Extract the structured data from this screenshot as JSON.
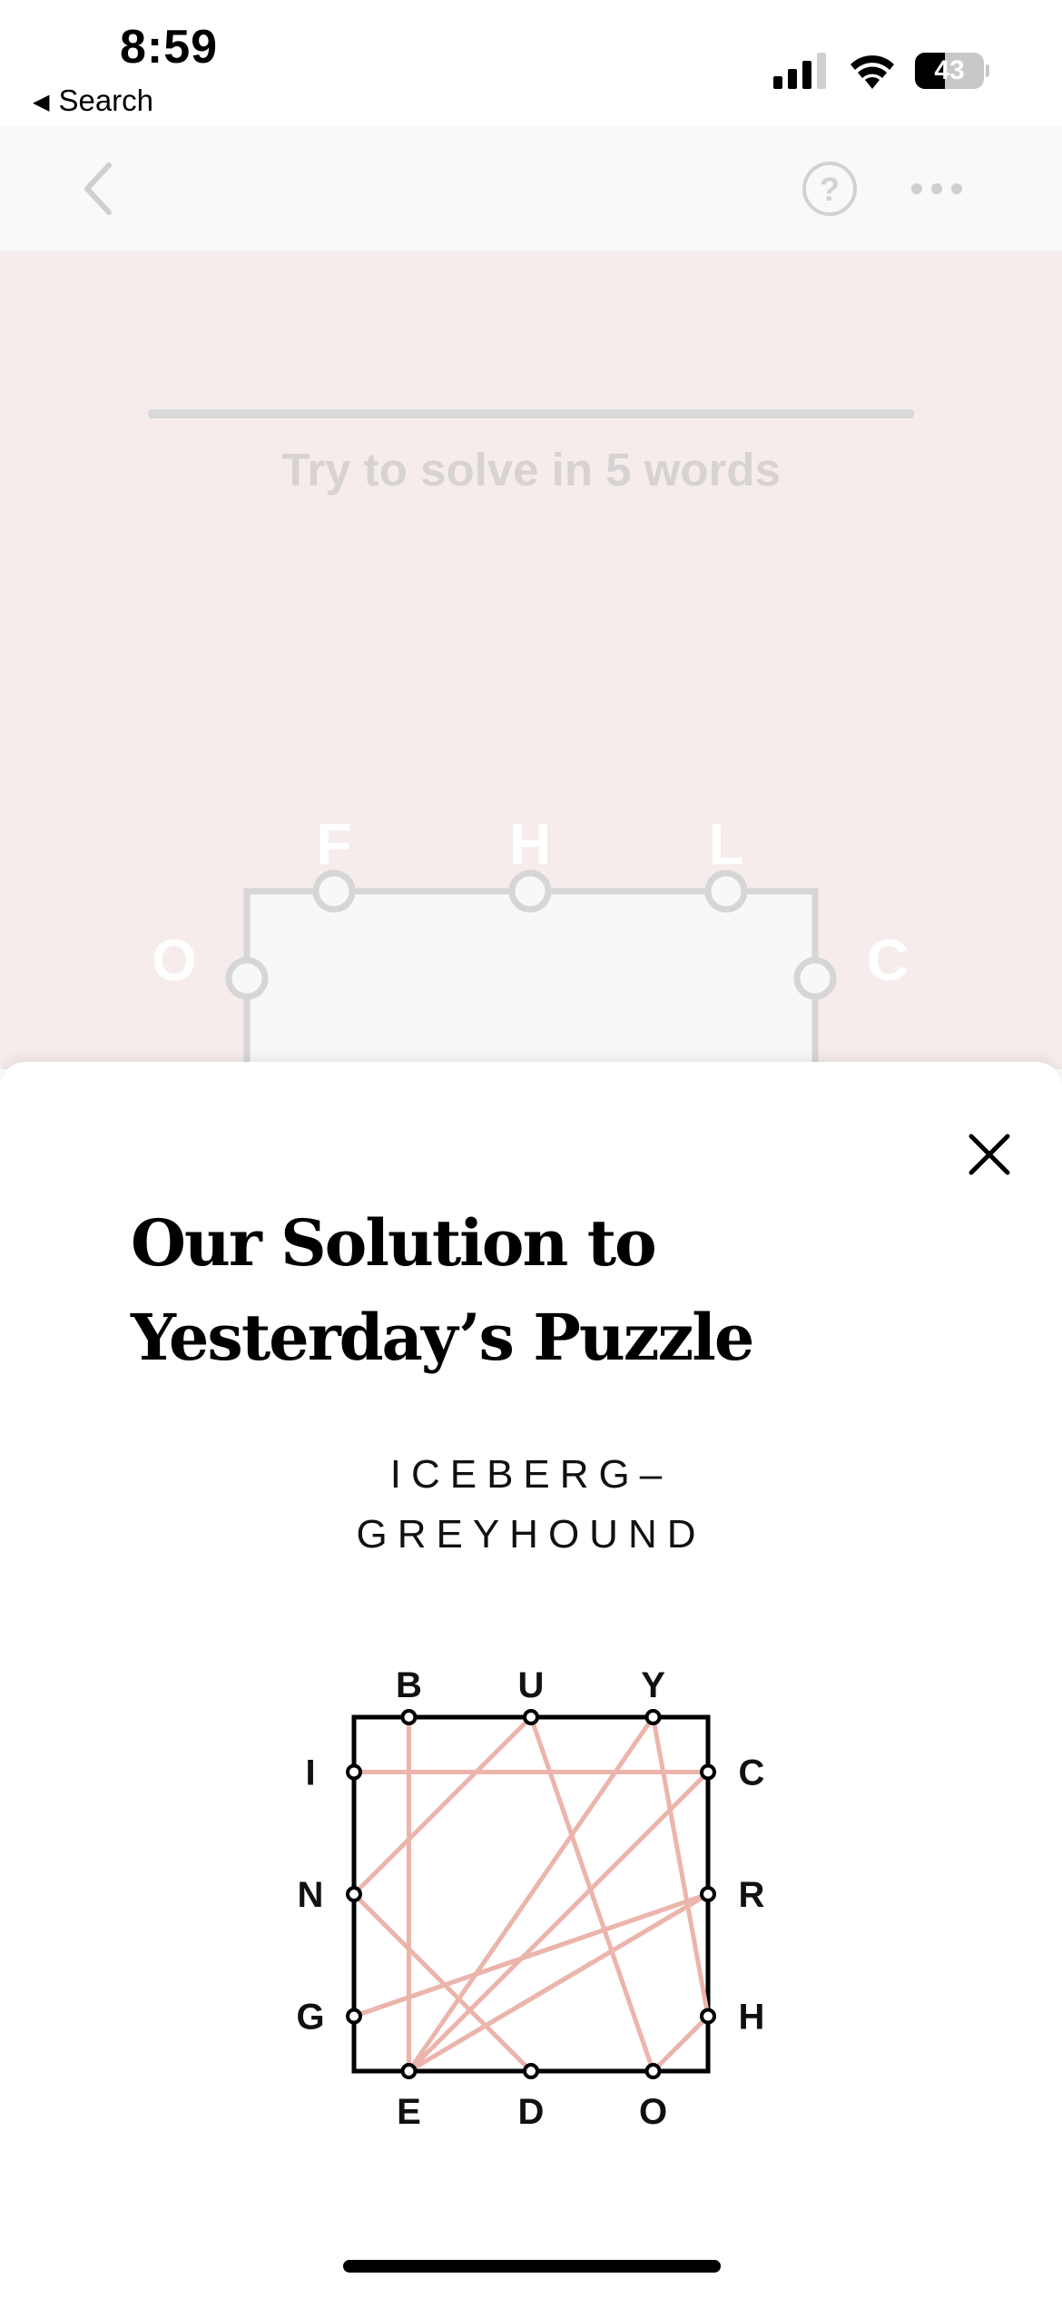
{
  "status_bar": {
    "time": "8:59",
    "back_label": "Search",
    "back_icon": "left-triangle-icon",
    "battery": "43",
    "icons": [
      "cellular-signal-icon",
      "wifi-icon",
      "battery-icon"
    ]
  },
  "navbar": {
    "icons": [
      "back-chevron-icon",
      "help-icon",
      "more-icon"
    ]
  },
  "game": {
    "hint": "Try to solve in 5 words",
    "box_letters": {
      "top": [
        "F",
        "H",
        "L"
      ],
      "left": [
        "O"
      ],
      "right": [
        "C"
      ]
    },
    "colors": {
      "background": "#f6ecec",
      "frame": "#d6d6d6",
      "letters": "#ffffff"
    }
  },
  "sheet": {
    "title": "Our Solution to Yesterday’s Puzzle",
    "answer_line1": "ICEBERG–",
    "answer_line2": "GREYHOUND",
    "close_icon": "close-icon",
    "diagram": {
      "top": [
        "B",
        "U",
        "Y"
      ],
      "left": [
        "I",
        "N",
        "G"
      ],
      "right": [
        "C",
        "R",
        "H"
      ],
      "bottom": [
        "E",
        "D",
        "O"
      ],
      "path_letters": [
        "I",
        "C",
        "E",
        "B",
        "E",
        "R",
        "G",
        "R",
        "E",
        "Y",
        "H",
        "O",
        "U",
        "N",
        "D"
      ],
      "colors": {
        "path": "#ebb5ac",
        "frame": "#000000"
      }
    }
  }
}
